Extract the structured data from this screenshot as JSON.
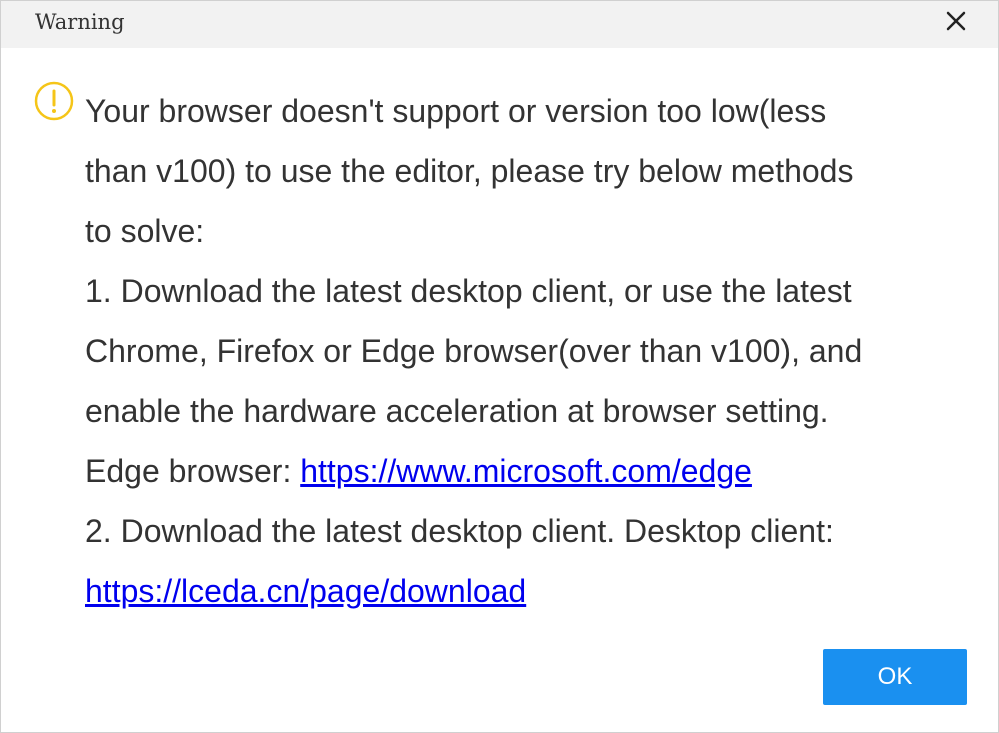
{
  "dialog": {
    "title": "Warning",
    "close_icon": "close-icon",
    "warning_icon": "exclamation-circle-icon",
    "colors": {
      "warning_icon": "#f5c518",
      "button": "#1a90f0",
      "link": "#0000ee",
      "titlebar": "#f2f2f2"
    },
    "message": {
      "line1": "Your browser doesn't support or version too low(less",
      "line2": "than v100) to use the editor, please try below methods",
      "line3": "to solve:",
      "line4": "1. Download the latest desktop client, or use the latest",
      "line5": "Chrome, Firefox or Edge browser(over than v100), and",
      "line6": "enable the hardware acceleration at browser setting.",
      "line7_prefix": "Edge browser: ",
      "edge_link": "https://www.microsoft.com/edge",
      "line8": "2. Download the latest desktop client. Desktop client:",
      "download_link": "https://lceda.cn/page/download"
    },
    "ok_label": "OK"
  }
}
